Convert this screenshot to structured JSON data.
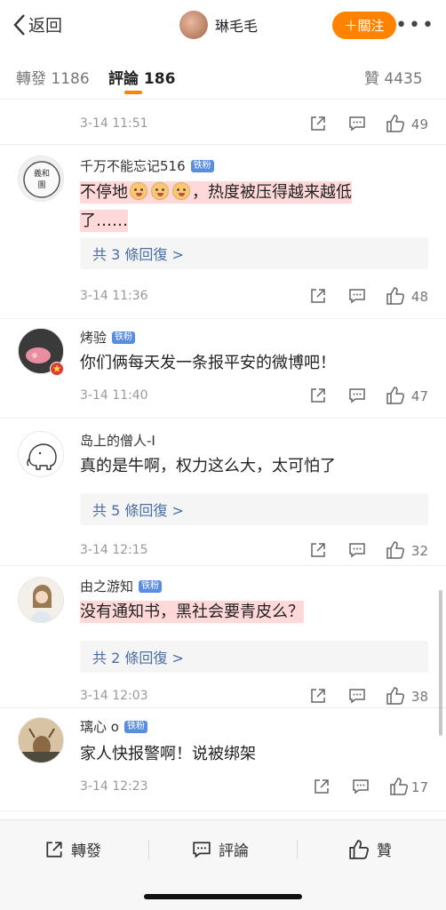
{
  "nav": {
    "back_label": "返回",
    "username": "琳毛毛",
    "follow_label": "＋關注",
    "more_label": "•••"
  },
  "tabs": {
    "repost": "轉發 1186",
    "comments": "評論 186",
    "likes": "贊 4435"
  },
  "top_meta": {
    "time": "3-14 11:51",
    "likes": "49"
  },
  "comments": [
    {
      "user": "千万不能忘记516",
      "badge": "铁粉",
      "text_a": "不停地",
      "text_b": "，热度被压得越来越低",
      "text_c": "了……",
      "replies": "共 3 條回復 >",
      "time": "3-14 11:36",
      "likes": "48"
    },
    {
      "user": "烤验",
      "badge": "铁粉",
      "text": "你们俩每天发一条报平安的微博吧！",
      "time": "3-14 11:40",
      "likes": "47"
    },
    {
      "user": "岛上的僧人-I",
      "text": "真的是牛啊，权力这么大，太可怕了",
      "replies": "共 5 條回復 >",
      "time": "3-14 12:15",
      "likes": "32"
    },
    {
      "user": "由之游知",
      "badge": "铁粉",
      "text": "没有通知书，黑社会要青皮么？",
      "replies": "共 2 條回復 >",
      "time": "3-14 12:03",
      "likes": "38"
    },
    {
      "user": "璃心 o",
      "badge": "铁粉",
      "text": "家人快报警啊！说被绑架",
      "time": "3-14 12:23",
      "likes": "17"
    }
  ],
  "bottom": {
    "repost": "轉發",
    "comment": "評論",
    "like": "贊"
  },
  "colors": {
    "accent": "#ff8200",
    "link": "#4a6fa5",
    "badge": "#5a8de0",
    "highlight": "#ffaaaa"
  }
}
